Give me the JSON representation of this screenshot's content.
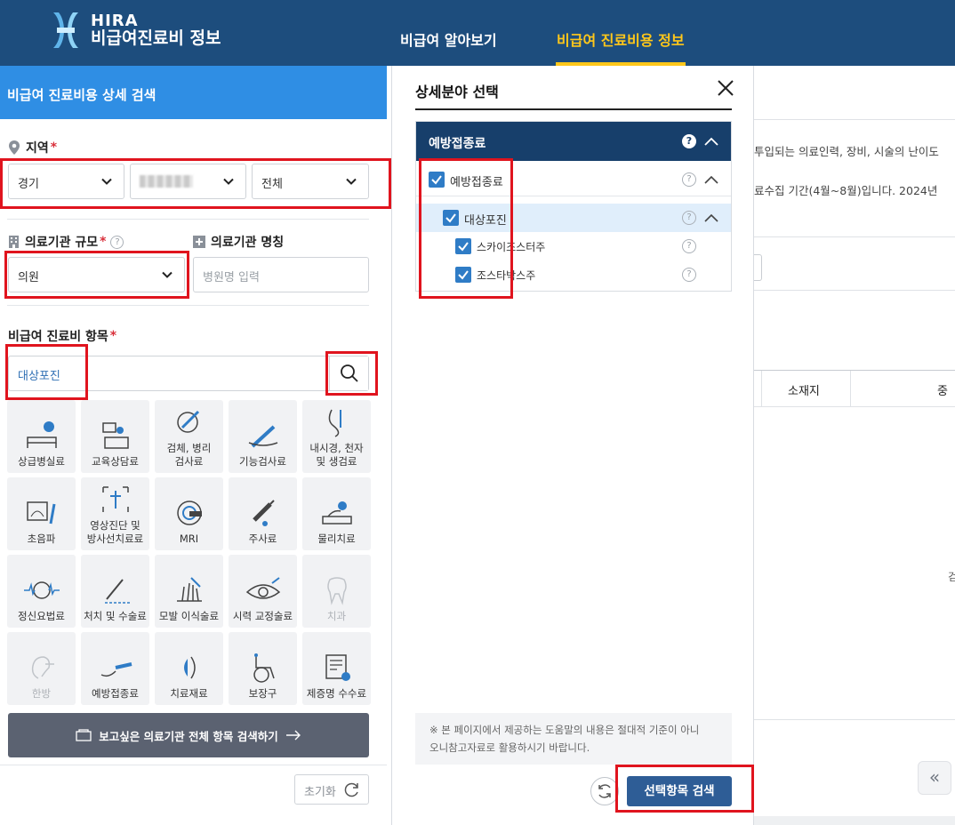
{
  "header": {
    "logo_brand": "HIRA",
    "logo_title": "비급여진료비 정보",
    "nav": [
      {
        "label": "비급여 알아보기",
        "active": false
      },
      {
        "label": "비급여 진료비용 정보",
        "active": true
      }
    ]
  },
  "search_panel": {
    "title": "비급여 진료비용 상세 검색",
    "region": {
      "label": "지역",
      "required_mark": "*",
      "sido": "경기",
      "sigungu": "",
      "dong": "전체"
    },
    "scale": {
      "label": "의료기관 규모",
      "required_mark": "*",
      "value": "의원"
    },
    "name": {
      "label": "의료기관 명칭",
      "placeholder": "병원명 입력"
    },
    "item": {
      "label": "비급여 진료비 항목",
      "required_mark": "*",
      "value": "대상포진"
    },
    "categories": [
      {
        "label": "상급병실료",
        "icon": "hospital-bed-icon",
        "enabled": true
      },
      {
        "label": "교육상담료",
        "icon": "consultation-icon",
        "enabled": true
      },
      {
        "label": "검체, 병리\n검사료",
        "icon": "specimen-test-icon",
        "enabled": true
      },
      {
        "label": "기능검사료",
        "icon": "function-test-icon",
        "enabled": true
      },
      {
        "label": "내시경, 천자\n및 생검료",
        "icon": "endoscope-icon",
        "enabled": true
      },
      {
        "label": "초음파",
        "icon": "ultrasound-icon",
        "enabled": true
      },
      {
        "label": "영상진단 및\n방사선치료료",
        "icon": "radiology-icon",
        "enabled": true
      },
      {
        "label": "MRI",
        "icon": "mri-icon",
        "enabled": true
      },
      {
        "label": "주사료",
        "icon": "syringe-icon",
        "enabled": true
      },
      {
        "label": "물리치료",
        "icon": "physical-therapy-icon",
        "enabled": true
      },
      {
        "label": "정신요법료",
        "icon": "psychotherapy-icon",
        "enabled": true
      },
      {
        "label": "처치 및 수술료",
        "icon": "surgery-icon",
        "enabled": true
      },
      {
        "label": "모발 이식술료",
        "icon": "hair-transplant-icon",
        "enabled": true
      },
      {
        "label": "시력 교정술료",
        "icon": "eye-icon",
        "enabled": true
      },
      {
        "label": "치과",
        "icon": "tooth-icon",
        "enabled": false
      },
      {
        "label": "한방",
        "icon": "oriental-medicine-icon",
        "enabled": false
      },
      {
        "label": "예방접종료",
        "icon": "vaccination-icon",
        "enabled": true
      },
      {
        "label": "치료재료",
        "icon": "medical-material-icon",
        "enabled": true
      },
      {
        "label": "보장구",
        "icon": "wheelchair-icon",
        "enabled": true
      },
      {
        "label": "제증명 수수료",
        "icon": "certificate-icon",
        "enabled": true
      }
    ],
    "all_items_button": "보고싶은 의료기관 전체 항목 검색하기",
    "reset_button": "초기화"
  },
  "modal": {
    "title": "상세분야 선택",
    "group_header": "예방접종료",
    "tree": [
      {
        "label": "예방접종료",
        "level": 1,
        "checked": true
      },
      {
        "label": "대상포진",
        "level": 2,
        "checked": true
      },
      {
        "label": "스카이조스터주",
        "level": 3,
        "checked": true
      },
      {
        "label": "조스타박스주",
        "level": 3,
        "checked": true
      }
    ],
    "notice_line1": "※ 본 페이지에서 제공하는 도움말의 내용은 절대적 기준이 아니",
    "notice_line2": "오니참고자료로 활용하시기 바랍니다.",
    "search_button": "선택항목 검색"
  },
  "background": {
    "text1": "투입되는 의료인력, 장비, 시술의 난이도",
    "text2": "료수집 기간(4월~8월)입니다. 2024년",
    "col_location": "소재지",
    "col_partial": "중",
    "partial_right": "검"
  },
  "colors": {
    "header_bg": "#1d4d7d",
    "nav_active": "#ffc71a",
    "panel_title_bg": "#2f8ee4",
    "highlight": "#e0141e",
    "checkbox": "#2f7cc6",
    "tree_header_bg": "#173f6b",
    "search_button": "#2e5d96"
  }
}
